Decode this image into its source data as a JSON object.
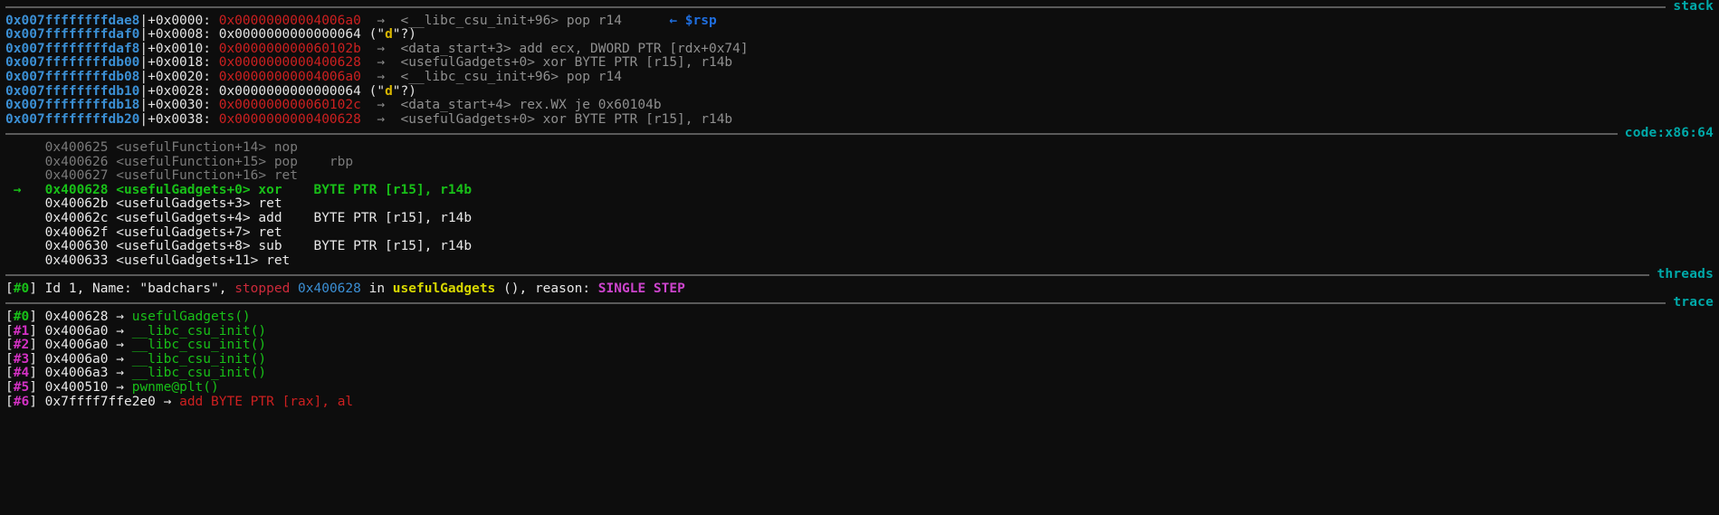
{
  "terminal": {
    "background": "#0d0d0d",
    "title": "gef gdb session"
  },
  "sections": {
    "stack": {
      "label": "stack",
      "color": "#00a9a9"
    },
    "code": {
      "label": "code:x86:64",
      "color": "#00a9a9"
    },
    "threads": {
      "label": "threads",
      "color": "#00a9a9"
    },
    "trace": {
      "label": "trace",
      "color": "#00a9a9"
    }
  },
  "stack": {
    "rows": [
      {
        "address": "0x007ffffffffdae8",
        "offset": "+0x0000:",
        "value": "0x00000000004006a0",
        "value_kind": "pointer",
        "arrow": "→",
        "symbol": "<__libc_csu_init+96> pop r14",
        "string_prefix": "",
        "string_char": "",
        "string_suffix": "",
        "marker": "← $rsp"
      },
      {
        "address": "0x007ffffffffdaf0",
        "offset": "+0x0008:",
        "value": "0x0000000000000064",
        "value_kind": "plain",
        "arrow": "",
        "symbol": "",
        "string_prefix": "(\"",
        "string_char": "d",
        "string_suffix": "\"?)",
        "marker": ""
      },
      {
        "address": "0x007ffffffffdaf8",
        "offset": "+0x0010:",
        "value": "0x000000000060102b",
        "value_kind": "pointer",
        "arrow": "→",
        "symbol": "<data_start+3> add ecx, DWORD PTR [rdx+0x74]",
        "string_prefix": "",
        "string_char": "",
        "string_suffix": "",
        "marker": ""
      },
      {
        "address": "0x007ffffffffdb00",
        "offset": "+0x0018:",
        "value": "0x0000000000400628",
        "value_kind": "pointer",
        "arrow": "→",
        "symbol": "<usefulGadgets+0> xor BYTE PTR [r15], r14b",
        "string_prefix": "",
        "string_char": "",
        "string_suffix": "",
        "marker": ""
      },
      {
        "address": "0x007ffffffffdb08",
        "offset": "+0x0020:",
        "value": "0x00000000004006a0",
        "value_kind": "pointer",
        "arrow": "→",
        "symbol": "<__libc_csu_init+96> pop r14",
        "string_prefix": "",
        "string_char": "",
        "string_suffix": "",
        "marker": ""
      },
      {
        "address": "0x007ffffffffdb10",
        "offset": "+0x0028:",
        "value": "0x0000000000000064",
        "value_kind": "plain",
        "arrow": "",
        "symbol": "",
        "string_prefix": "(\"",
        "string_char": "d",
        "string_suffix": "\"?)",
        "marker": ""
      },
      {
        "address": "0x007ffffffffdb18",
        "offset": "+0x0030:",
        "value": "0x000000000060102c",
        "value_kind": "pointer",
        "arrow": "→",
        "symbol": "<data_start+4> rex.WX je 0x60104b",
        "string_prefix": "",
        "string_char": "",
        "string_suffix": "",
        "marker": ""
      },
      {
        "address": "0x007ffffffffdb20",
        "offset": "+0x0038:",
        "value": "0x0000000000400628",
        "value_kind": "pointer",
        "arrow": "→",
        "symbol": "<usefulGadgets+0> xor BYTE PTR [r15], r14b",
        "string_prefix": "",
        "string_char": "",
        "string_suffix": "",
        "marker": ""
      }
    ]
  },
  "code": {
    "rows": [
      {
        "marker": "",
        "text": "0x400625 <usefulFunction+14> nop",
        "state": "past"
      },
      {
        "marker": "",
        "text": "0x400626 <usefulFunction+15> pop    rbp",
        "state": "past"
      },
      {
        "marker": "",
        "text": "0x400627 <usefulFunction+16> ret",
        "state": "past"
      },
      {
        "marker": "→",
        "text": "0x400628 <usefulGadgets+0> xor    BYTE PTR [r15], r14b",
        "state": "current"
      },
      {
        "marker": "",
        "text": "0x40062b <usefulGadgets+3> ret",
        "state": "future"
      },
      {
        "marker": "",
        "text": "0x40062c <usefulGadgets+4> add    BYTE PTR [r15], r14b",
        "state": "future"
      },
      {
        "marker": "",
        "text": "0x40062f <usefulGadgets+7> ret",
        "state": "future"
      },
      {
        "marker": "",
        "text": "0x400630 <usefulGadgets+8> sub    BYTE PTR [r15], r14b",
        "state": "future"
      },
      {
        "marker": "",
        "text": "0x400633 <usefulGadgets+11> ret",
        "state": "future"
      }
    ]
  },
  "threads": {
    "rows": [
      {
        "bracket_open": "[",
        "index": "#0",
        "bracket_close": "]",
        "id_text": " Id 1, Name: \"badchars\", ",
        "stopped_label": "stopped",
        "stopped_addr": "0x400628",
        "in_text": " in ",
        "function": "usefulGadgets",
        "post_fn": " (), reason: ",
        "reason": "SINGLE STEP"
      }
    ]
  },
  "trace": {
    "rows": [
      {
        "index": "#0",
        "address": "0x400628",
        "arrow": "→",
        "symbol": "usefulGadgets()",
        "kind": "function",
        "current": true
      },
      {
        "index": "#1",
        "address": "0x4006a0",
        "arrow": "→",
        "symbol": "__libc_csu_init()",
        "kind": "function",
        "current": false
      },
      {
        "index": "#2",
        "address": "0x4006a0",
        "arrow": "→",
        "symbol": "__libc_csu_init()",
        "kind": "function",
        "current": false
      },
      {
        "index": "#3",
        "address": "0x4006a0",
        "arrow": "→",
        "symbol": "__libc_csu_init()",
        "kind": "function",
        "current": false
      },
      {
        "index": "#4",
        "address": "0x4006a3",
        "arrow": "→",
        "symbol": "__libc_csu_init()",
        "kind": "function",
        "current": false
      },
      {
        "index": "#5",
        "address": "0x400510",
        "arrow": "→",
        "symbol": "pwnme@plt()",
        "kind": "function",
        "current": false
      },
      {
        "index": "#6",
        "address": "0x7ffff7ffe2e0",
        "arrow": "→",
        "symbol": "add BYTE PTR [rax], al",
        "kind": "instruction",
        "current": false
      }
    ]
  }
}
